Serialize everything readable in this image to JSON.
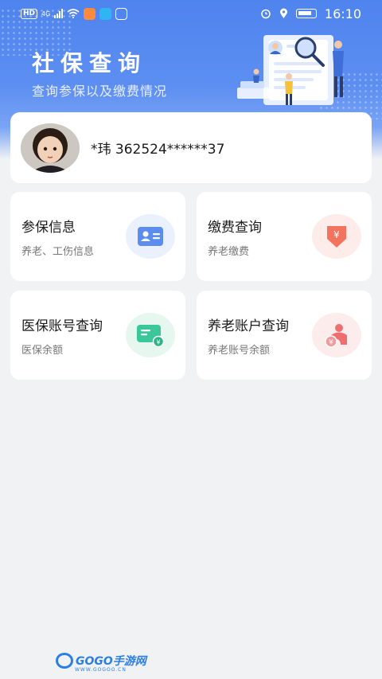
{
  "status_bar": {
    "hd": "HD",
    "network": "4G",
    "time": "16:10"
  },
  "header": {
    "title": "社保查询",
    "subtitle": "查询参保以及缴费情况"
  },
  "profile": {
    "name_id": "*玮 362524******37"
  },
  "cards": [
    {
      "title": "参保信息",
      "subtitle": "养老、工伤信息",
      "icon": "id-card-icon",
      "color": "#5b8def"
    },
    {
      "title": "缴费查询",
      "subtitle": "养老缴费",
      "icon": "yuan-down-icon",
      "color": "#f2745e"
    },
    {
      "title": "医保账号查询",
      "subtitle": "医保余额",
      "icon": "medical-card-icon",
      "color": "#3cc79a"
    },
    {
      "title": "养老账户查询",
      "subtitle": "养老账号余额",
      "icon": "elder-yuan-icon",
      "color": "#ee6f6f"
    }
  ],
  "watermark": {
    "brand": "GOGO手游网",
    "url": "WWW.GOGOO.CN"
  },
  "colors": {
    "header_blue": "#4f83ee",
    "background": "#f1f2f4"
  }
}
